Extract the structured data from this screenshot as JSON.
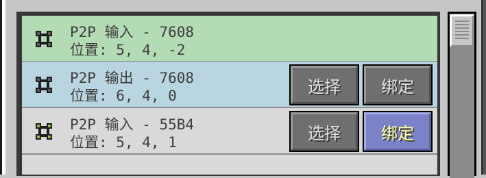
{
  "colors": {
    "input_row": "#b3dbb4",
    "output_row": "#b8d5e1",
    "plain_row": "#d9d9d9",
    "button_face": "#6f6f6f",
    "button_hover": "#7c82c8",
    "button_hover_text": "#ffffa0"
  },
  "rows": [
    {
      "icon": "p2p-tunnel-icon",
      "title": "P2P 输入 - 7608",
      "position": "位置: 5, 4, -2",
      "state": "input-highlight"
    },
    {
      "icon": "p2p-tunnel-icon",
      "title": "P2P 输出 - 7608",
      "position": "位置: 6, 4, 0",
      "select_label": "选择",
      "bind_label": "绑定"
    },
    {
      "icon": "p2p-tunnel-icon",
      "title": "P2P 输入 - 55B4",
      "position": "位置: 5, 4, 1",
      "select_label": "选择",
      "bind_label": "绑定",
      "bind_state": "hovered"
    }
  ],
  "scrollbar": {
    "position": 0
  }
}
